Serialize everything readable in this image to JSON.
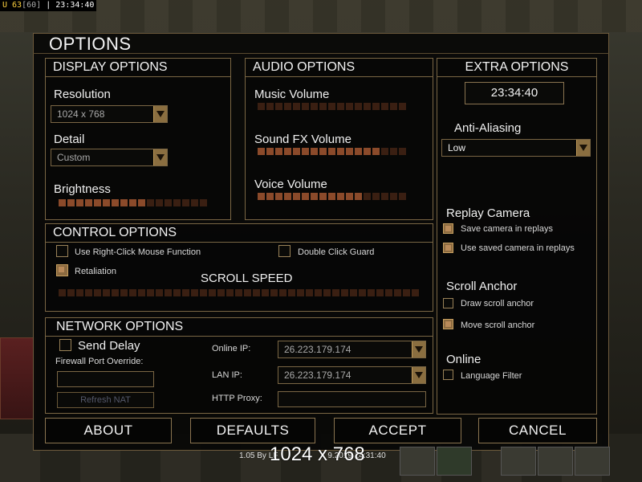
{
  "topbar": {
    "u": "U 63",
    "fps": "[60]",
    "sep": "|",
    "time": "23:34:40"
  },
  "title": "OPTIONS",
  "display": {
    "heading": "DISPLAY OPTIONS",
    "resolution_label": "Resolution",
    "resolution_value": "1024 x 768",
    "detail_label": "Detail",
    "detail_value": "Custom",
    "brightness_label": "Brightness",
    "brightness_level": 0.59
  },
  "audio": {
    "heading": "AUDIO OPTIONS",
    "music_label": "Music Volume",
    "music_level": 0,
    "sfx_label": "Sound FX Volume",
    "sfx_level": 0.82,
    "voice_label": "Voice Volume",
    "voice_level": 0.68
  },
  "control": {
    "heading": "CONTROL OPTIONS",
    "right_click_label": "Use Right-Click Mouse Function",
    "right_click_checked": false,
    "double_click_label": "Double Click Guard",
    "double_click_checked": false,
    "retaliation_label": "Retaliation",
    "retaliation_checked": true,
    "scroll_speed_label": "SCROLL SPEED",
    "scroll_speed_level": 0
  },
  "network": {
    "heading": "NETWORK OPTIONS",
    "send_delay_label": "Send Delay",
    "send_delay_checked": false,
    "firewall_label": "Firewall Port Override:",
    "firewall_value": "",
    "refresh_nat_label": "Refresh NAT",
    "online_ip_label": "Online IP:",
    "online_ip_value": "26.223.179.174",
    "lan_ip_label": "LAN IP:",
    "lan_ip_value": "26.223.179.174",
    "http_proxy_label": "HTTP Proxy:",
    "http_proxy_value": ""
  },
  "extra": {
    "heading": "EXTRA OPTIONS",
    "clock": "23:34:40",
    "anti_aliasing_label": "Anti-Aliasing",
    "anti_aliasing_value": "Low",
    "replay_camera_label": "Replay Camera",
    "save_camera_label": "Save camera in replays",
    "save_camera_checked": true,
    "use_saved_camera_label": "Use saved camera in replays",
    "use_saved_camera_checked": true,
    "scroll_anchor_label": "Scroll Anchor",
    "draw_scroll_anchor_label": "Draw scroll anchor",
    "draw_scroll_anchor_checked": false,
    "move_scroll_anchor_label": "Move scroll anchor",
    "move_scroll_anchor_checked": true,
    "online_label": "Online",
    "language_filter_label": "Language Filter",
    "language_filter_checked": false
  },
  "buttons": {
    "about": "ABOUT",
    "defaults": "DEFAULTS",
    "accept": "ACCEPT",
    "cancel": "CANCEL"
  },
  "footer": {
    "version": "1.05 By LF",
    "time_fragment": "9.2019 14:31:40",
    "resolution_overlay": "1024 x 768"
  },
  "colors": {
    "accent": "#8b4a2a",
    "accent_dim": "#3a1f12",
    "border": "#7a6644",
    "dropdown_arrow": "#8a6e40"
  }
}
